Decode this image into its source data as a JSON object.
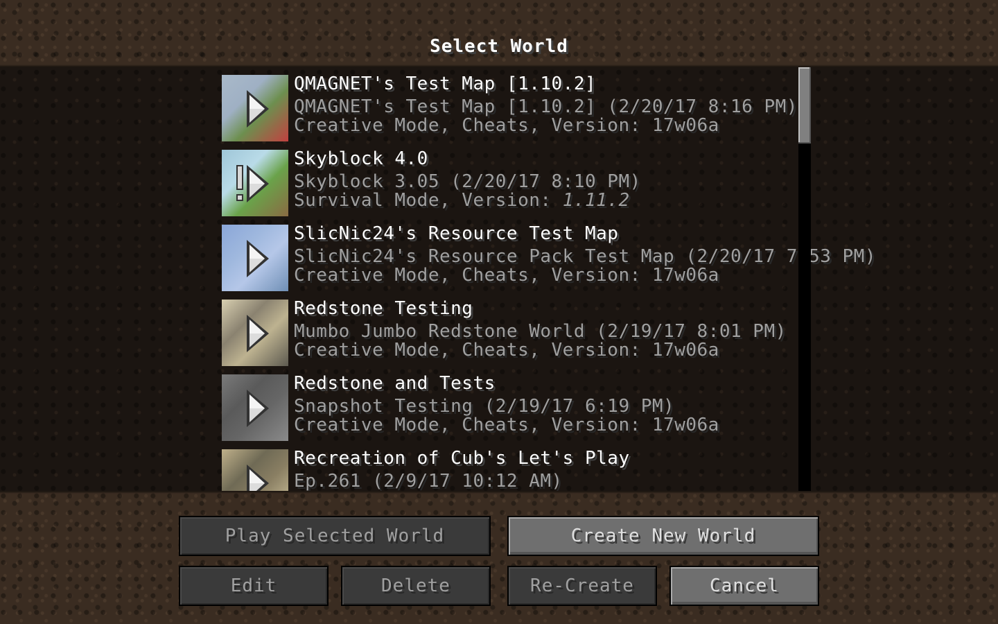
{
  "screen": {
    "title": "Select World"
  },
  "worlds": [
    {
      "name": "QMAGNET's Test Map [1.10.2]",
      "info": "QMAGNET's Test Map [1.10.2] (2/20/17 8:16 PM)",
      "mode": "Creative Mode, Cheats, Version: 17w06a",
      "mode_prefix": "",
      "version_italic": "",
      "warning": false,
      "thumb_colors": [
        "#a9b9c9",
        "#6d8f4f",
        "#c24040",
        "#9fb0c4"
      ]
    },
    {
      "name": "Skyblock 4.0",
      "info": "Skyblock 3.05 (2/20/17 8:10 PM)",
      "mode": "",
      "mode_prefix": "Survival Mode, Version: ",
      "version_italic": "1.11.2",
      "warning": true,
      "thumb_colors": [
        "#9fc6d8",
        "#6aa24a",
        "#8a6a43",
        "#b9dbe8"
      ]
    },
    {
      "name": "SlicNic24's Resource Test Map",
      "info": "SlicNic24's Resource Pack Test Map (2/20/17 7:53 PM)",
      "mode": "Creative Mode, Cheats, Version: 17w06a",
      "mode_prefix": "",
      "version_italic": "",
      "warning": false,
      "thumb_colors": [
        "#8aa6d8",
        "#b5c7e8",
        "#6f8fb5",
        "#9fb8de"
      ]
    },
    {
      "name": "Redstone Testing",
      "info": "Mumbo Jumbo Redstone World (2/19/17 8:01 PM)",
      "mode": "Creative Mode, Cheats, Version: 17w06a",
      "mode_prefix": "",
      "version_italic": "",
      "warning": false,
      "thumb_colors": [
        "#d8cfb0",
        "#bdb290",
        "#5d5a50",
        "#8a8270"
      ]
    },
    {
      "name": "Redstone and Tests",
      "info": "Snapshot Testing (2/19/17 6:19 PM)",
      "mode": "Creative Mode, Cheats, Version: 17w06a",
      "mode_prefix": "",
      "version_italic": "",
      "warning": false,
      "thumb_colors": [
        "#7a7a7a",
        "#666666",
        "#8a8a8a",
        "#5a5a5a"
      ]
    },
    {
      "name": "Recreation of Cub's Let's Play",
      "info": "Ep.261 (2/9/17 10:12 AM)",
      "mode": "",
      "mode_prefix": "",
      "version_italic": "",
      "warning": false,
      "thumb_colors": [
        "#bfb08a",
        "#8a7f63",
        "#d3c7a0",
        "#6f6a55"
      ]
    }
  ],
  "buttons": {
    "play_selected": "Play Selected World",
    "create_new": "Create New World",
    "edit": "Edit",
    "delete": "Delete",
    "recreate": "Re-Create",
    "cancel": "Cancel"
  },
  "icons": {
    "play": "play-arrow-icon",
    "warning": "warning-exclamation-icon"
  }
}
